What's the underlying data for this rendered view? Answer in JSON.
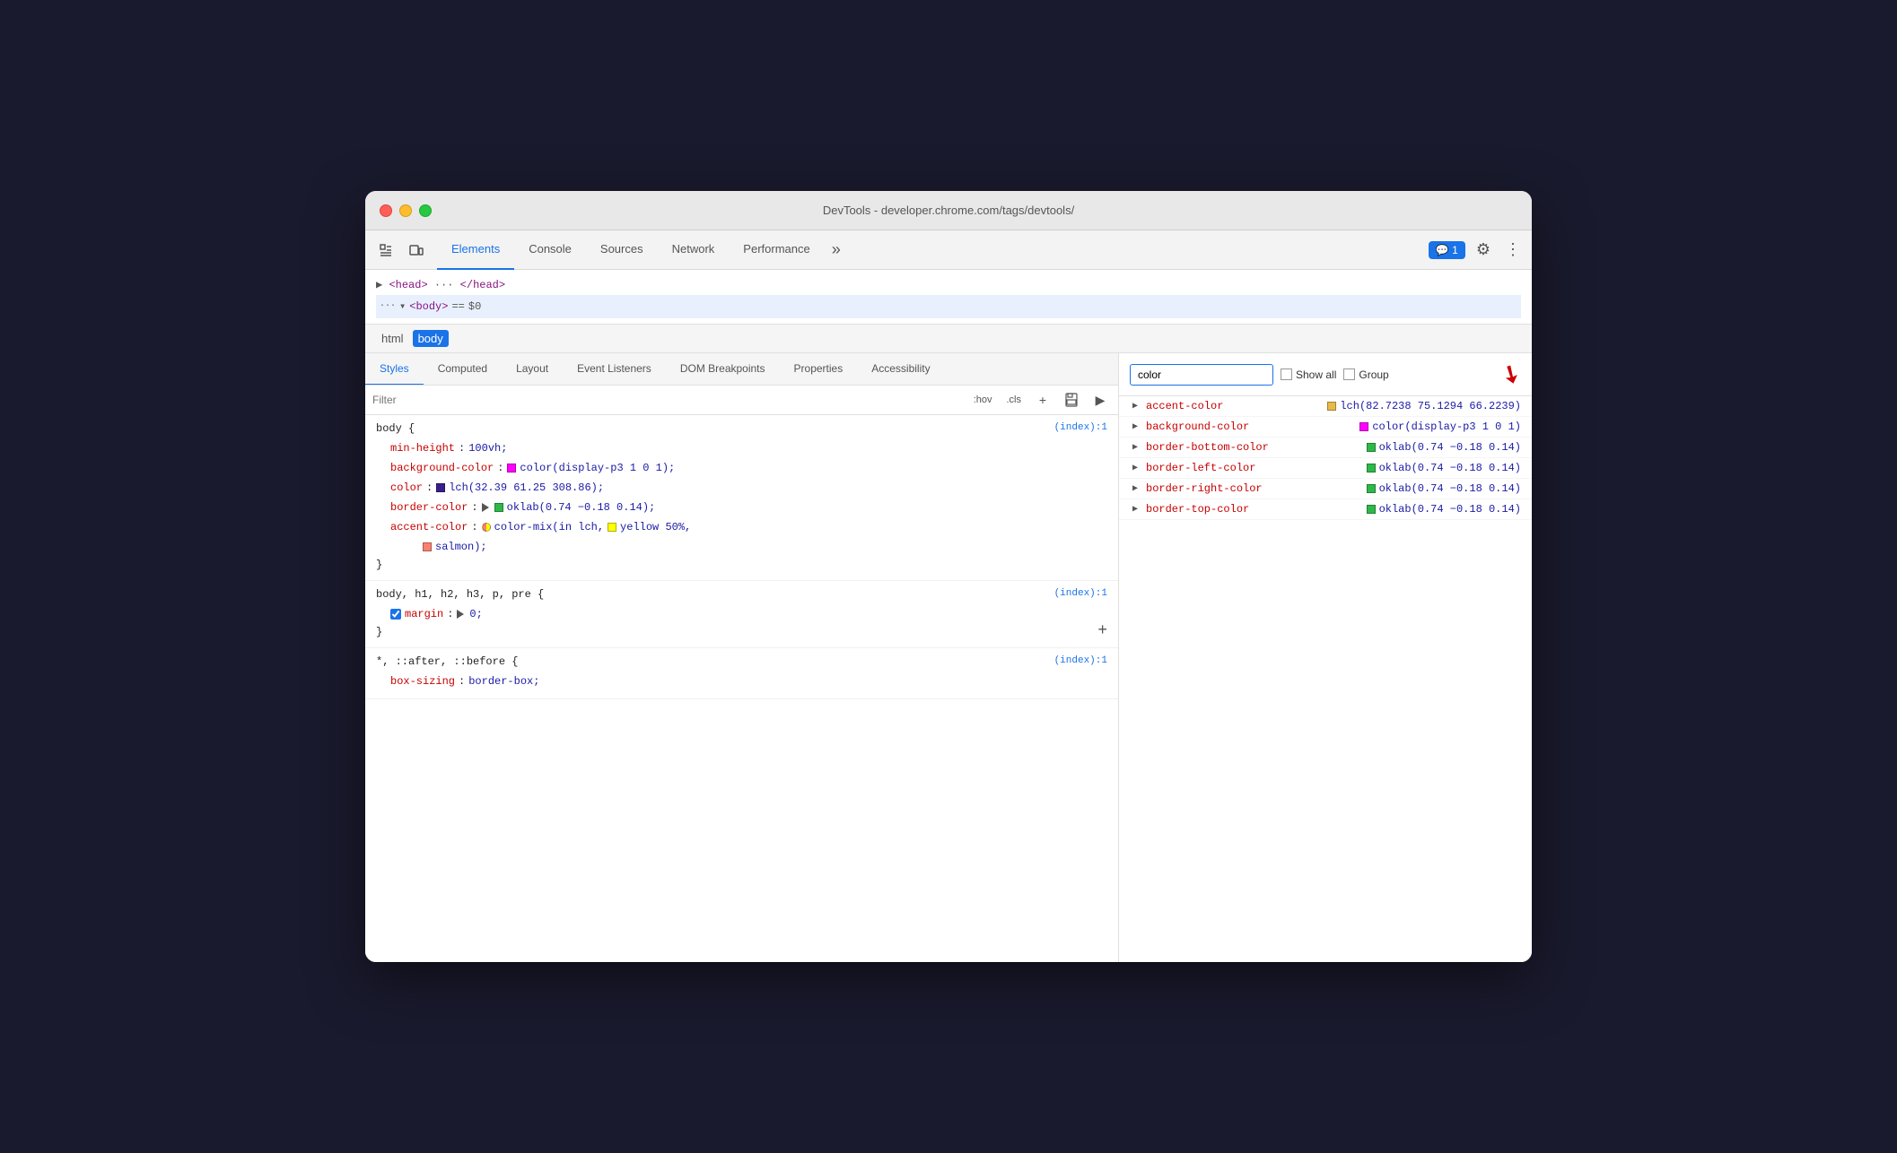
{
  "window": {
    "title": "DevTools - developer.chrome.com/tags/devtools/"
  },
  "toolbar": {
    "tabs": [
      {
        "label": "Elements",
        "active": true
      },
      {
        "label": "Console",
        "active": false
      },
      {
        "label": "Sources",
        "active": false
      },
      {
        "label": "Network",
        "active": false
      },
      {
        "label": "Performance",
        "active": false
      }
    ],
    "more_label": "»",
    "chat_badge": "💬 1",
    "gear_icon": "⚙",
    "dots_icon": "⋮"
  },
  "dom": {
    "line1": "▶ <head> ··· </head>",
    "line2_prefix": "··· ▾ <body>",
    "line2_eq": "==",
    "line2_dollar": "$0"
  },
  "breadcrumb": {
    "items": [
      {
        "label": "html",
        "active": false
      },
      {
        "label": "body",
        "active": true
      }
    ]
  },
  "style_tabs": {
    "tabs": [
      {
        "label": "Styles",
        "active": true
      },
      {
        "label": "Computed",
        "active": false
      },
      {
        "label": "Layout",
        "active": false
      },
      {
        "label": "Event Listeners",
        "active": false
      },
      {
        "label": "DOM Breakpoints",
        "active": false
      },
      {
        "label": "Properties",
        "active": false
      },
      {
        "label": "Accessibility",
        "active": false
      }
    ]
  },
  "filter": {
    "placeholder": "Filter",
    "hov_label": ":hov",
    "cls_label": ".cls",
    "plus_icon": "+",
    "save_icon": "💾",
    "play_icon": "▶"
  },
  "css_rules": [
    {
      "selector": "body {",
      "file": "(index):1",
      "properties": [
        {
          "name": "min-height",
          "colon": ":",
          "value": "100vh;",
          "swatch": null,
          "checkbox": false
        },
        {
          "name": "background-color",
          "colon": ":",
          "value": "color(display-p3 1 0 1);",
          "swatch": {
            "color": "#ff00ff"
          },
          "checkbox": false
        },
        {
          "name": "color",
          "colon": ":",
          "value": "lch(32.39 61.25 308.86);",
          "swatch": {
            "color": "#3b1e8e"
          },
          "checkbox": false
        },
        {
          "name": "border-color",
          "colon": ":",
          "value": "oklab(0.74 −0.18 0.14);",
          "swatch": {
            "color": "#2eb84a"
          },
          "checkbox": false,
          "has_triangle": true
        },
        {
          "name": "accent-color",
          "colon": ":",
          "value": "color-mix(in lch, yellow 50%, salmon);",
          "swatch": null,
          "color_mix": true,
          "checkbox": false
        }
      ],
      "has_arrow_annotation": true
    },
    {
      "selector": "body, h1, h2, h3, p, pre {",
      "file": "(index):1",
      "properties": [
        {
          "name": "margin",
          "colon": ":",
          "value": "▶ 0;",
          "swatch": null,
          "checkbox": true
        }
      ],
      "has_plus": true
    },
    {
      "selector": "*, ::after, ::before {",
      "file": "(index):1",
      "properties": [
        {
          "name": "box-sizing",
          "colon": ":",
          "value": "border-box;",
          "swatch": null,
          "checkbox": false
        }
      ]
    }
  ],
  "computed_panel": {
    "search_placeholder": "color",
    "show_all_label": "Show all",
    "group_label": "Group",
    "items": [
      {
        "name": "accent-color",
        "value": "lch(82.7238 75.1294 66.2239)",
        "swatch": {
          "color": "#e8b84b"
        },
        "has_arrow": true
      },
      {
        "name": "background-color",
        "value": "color(display-p3 1 0 1)",
        "swatch": {
          "color": "#ff00ff"
        }
      },
      {
        "name": "border-bottom-color",
        "value": "oklab(0.74 −0.18 0.14)",
        "swatch": {
          "color": "#2eb84a"
        }
      },
      {
        "name": "border-left-color",
        "value": "oklab(0.74 −0.18 0.14)",
        "swatch": {
          "color": "#2eb84a"
        }
      },
      {
        "name": "border-right-color",
        "value": "oklab(0.74 −0.18 0.14)",
        "swatch": {
          "color": "#2eb84a"
        }
      },
      {
        "name": "border-top-color",
        "value": "oklab(0.74 −0.18 0.14)",
        "swatch": {
          "color": "#2eb84a"
        }
      }
    ]
  }
}
